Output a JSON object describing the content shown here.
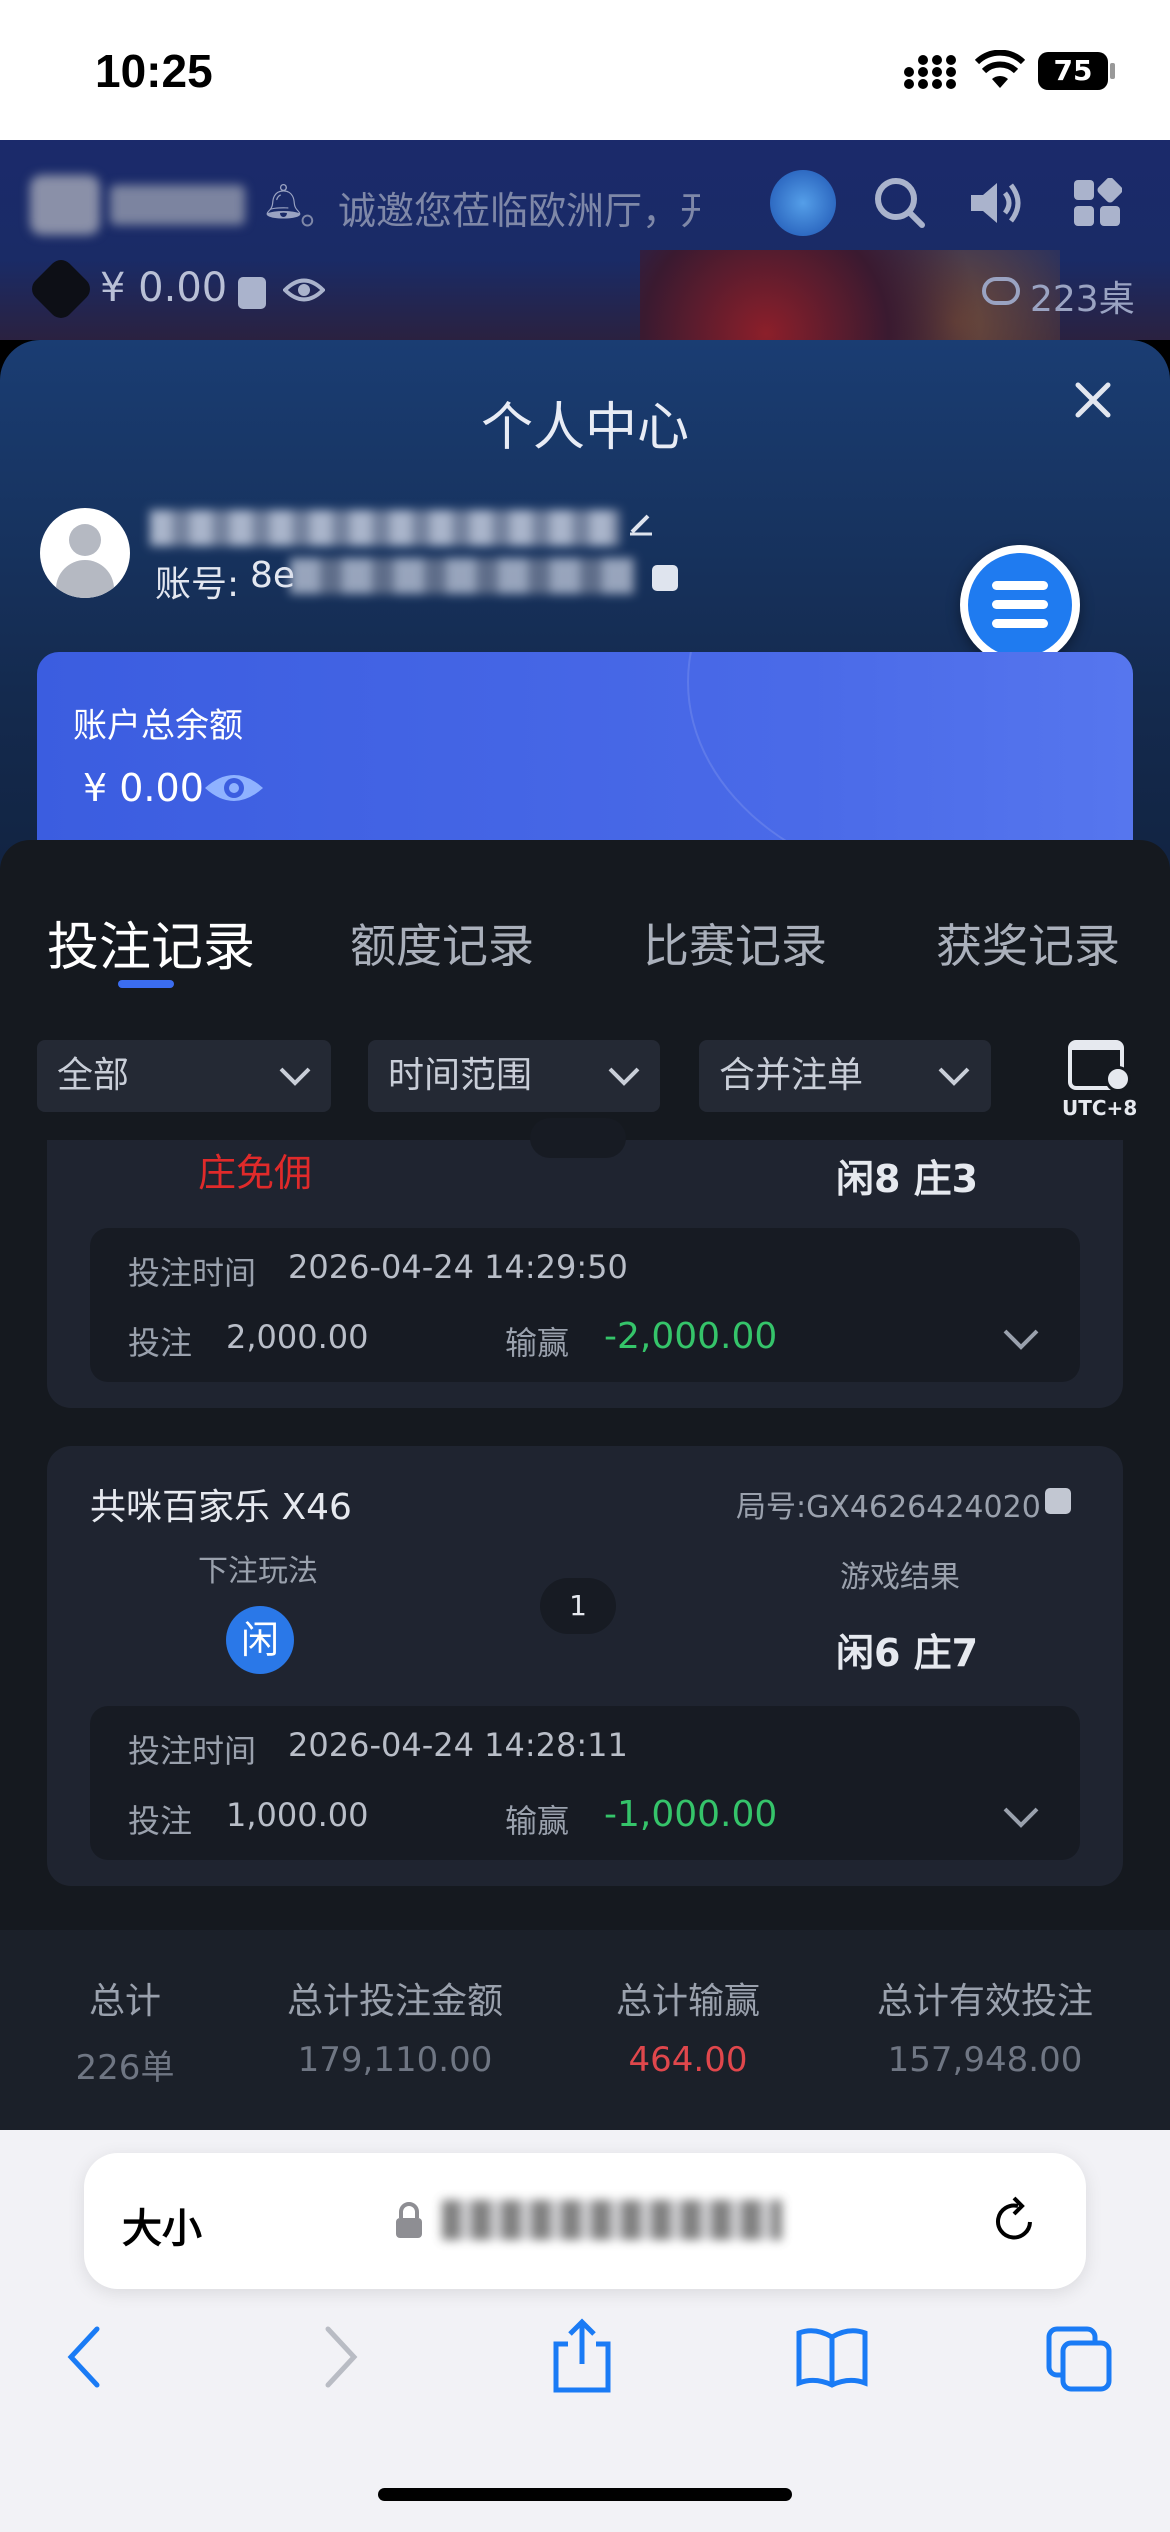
{
  "status_bar": {
    "time": "10:25",
    "battery": "75"
  },
  "app_header": {
    "marquee": "。诚邀您莅临欧洲厅，开",
    "balance": "¥ 0.00",
    "tables": "223桌"
  },
  "panel": {
    "title": "个人中心",
    "account_label": "账号:",
    "account_prefix": "8e",
    "balance_card": {
      "label": "账户总余额",
      "amount": "¥ 0.00"
    }
  },
  "tabs": [
    {
      "label": "投注记录",
      "active": true
    },
    {
      "label": "额度记录",
      "active": false
    },
    {
      "label": "比赛记录",
      "active": false
    },
    {
      "label": "获奖记录",
      "active": false
    }
  ],
  "filters": {
    "all": "全部",
    "time_range": "时间范围",
    "merge": "合并注单",
    "timezone": "UTC+8"
  },
  "records": [
    {
      "bet_type": "庄免佣",
      "result": "闲8 庄3",
      "time_label": "投注时间",
      "time": "2026-04-24 14:29:50",
      "bet_label": "投注",
      "bet": "2,000.00",
      "winloss_label": "输赢",
      "winloss": "-2,000.00"
    },
    {
      "game": "共咪百家乐 X46",
      "round": "局号:GX4626424020",
      "play_label": "下注玩法",
      "play": "闲",
      "count": "1",
      "result_label": "游戏结果",
      "result": "闲6 庄7",
      "time_label": "投注时间",
      "time": "2026-04-24 14:28:11",
      "bet_label": "投注",
      "bet": "1,000.00",
      "winloss_label": "输赢",
      "winloss": "-1,000.00"
    }
  ],
  "summary": [
    {
      "label": "总计",
      "value": "226单"
    },
    {
      "label": "总计投注金额",
      "value": "179,110.00"
    },
    {
      "label": "总计输赢",
      "value": "464.00"
    },
    {
      "label": "总计有效投注",
      "value": "157,948.00"
    }
  ],
  "safari": {
    "text_size": "大小"
  },
  "colors": {
    "accent": "#3b5de0",
    "loss": "#35c46a",
    "total_winloss": "#e0474c",
    "free_commission": "#e02a2a"
  }
}
